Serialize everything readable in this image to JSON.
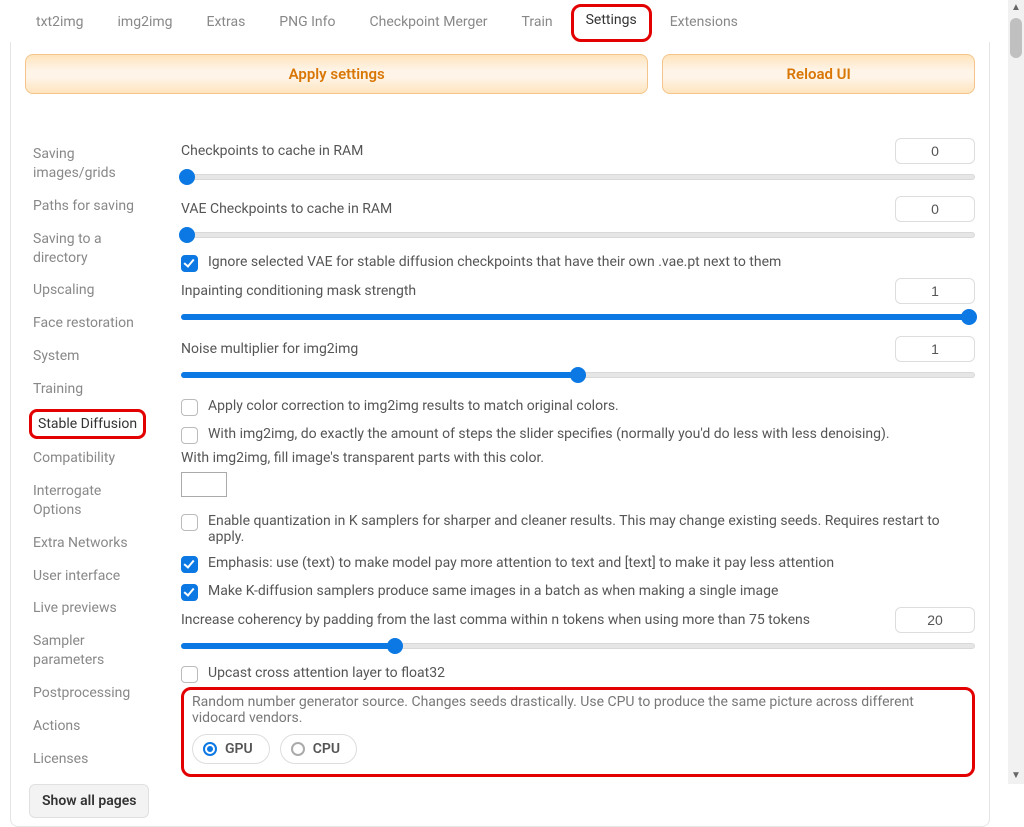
{
  "tabs": {
    "txt2img": "txt2img",
    "img2img": "img2img",
    "extras": "Extras",
    "pnginfo": "PNG Info",
    "checkpoint_merger": "Checkpoint Merger",
    "train": "Train",
    "settings": "Settings",
    "extensions": "Extensions"
  },
  "actions": {
    "apply": "Apply settings",
    "reload": "Reload UI"
  },
  "sidebar": {
    "items": {
      "saving_images": "Saving images/grids",
      "paths": "Paths for saving",
      "saving_dir": "Saving to a directory",
      "upscaling": "Upscaling",
      "face_restoration": "Face restoration",
      "system": "System",
      "training": "Training",
      "stable_diffusion": "Stable Diffusion",
      "compatibility": "Compatibility",
      "interrogate": "Interrogate Options",
      "extra_networks": "Extra Networks",
      "user_interface": "User interface",
      "live_previews": "Live previews",
      "sampler_params": "Sampler parameters",
      "postprocessing": "Postprocessing",
      "actions": "Actions",
      "licenses": "Licenses"
    },
    "show_all": "Show all pages"
  },
  "settings": {
    "ckpt_cache_label": "Checkpoints to cache in RAM",
    "ckpt_cache_value": "0",
    "vae_cache_label": "VAE Checkpoints to cache in RAM",
    "vae_cache_value": "0",
    "ignore_vae": "Ignore selected VAE for stable diffusion checkpoints that have their own .vae.pt next to them",
    "inpaint_mask_label": "Inpainting conditioning mask strength",
    "inpaint_mask_value": "1",
    "noise_mult_label": "Noise multiplier for img2img",
    "noise_mult_value": "1",
    "color_correction": "Apply color correction to img2img results to match original colors.",
    "exact_steps": "With img2img, do exactly the amount of steps the slider specifies (normally you'd do less with less denoising).",
    "fill_transparent": "With img2img, fill image's transparent parts with this color.",
    "quantization": "Enable quantization in K samplers for sharper and cleaner results. This may change existing seeds. Requires restart to apply.",
    "emphasis": "Emphasis: use (text) to make model pay more attention to text and [text] to make it pay less attention",
    "batch_same": "Make K-diffusion samplers produce same images in a batch as when making a single image",
    "coherency_label": "Increase coherency by padding from the last comma within n tokens when using more than 75 tokens",
    "coherency_value": "20",
    "upcast": "Upcast cross attention layer to float32",
    "rng_desc": "Random number generator source. Changes seeds drastically. Use CPU to produce the same picture across different vidocard vendors.",
    "rng_gpu": "GPU",
    "rng_cpu": "CPU"
  }
}
